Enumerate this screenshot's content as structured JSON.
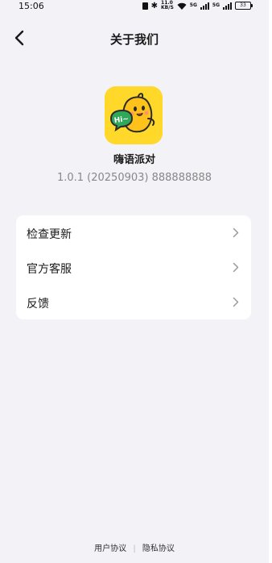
{
  "status_bar": {
    "time": "15:06",
    "net_speed_top": "11.0",
    "net_speed_bottom": "KB/S",
    "signal_label_1": "5G",
    "signal_label_2": "5G",
    "battery": "33"
  },
  "nav": {
    "title": "关于我们",
    "back_icon": "chevron-left-icon"
  },
  "app": {
    "name": "嗨语派对",
    "version": "1.0.1 (20250903) 888888888",
    "icon_text": "Hi~",
    "icon_bg": "#ffd82a"
  },
  "menu": {
    "items": [
      {
        "label": "检查更新"
      },
      {
        "label": "官方客服"
      },
      {
        "label": "反馈"
      }
    ]
  },
  "footer": {
    "user_agreement": "用户协议",
    "divider": "|",
    "privacy_policy": "隐私协议"
  },
  "colors": {
    "background": "#f2f2f7",
    "card": "#ffffff",
    "accent_yellow": "#ffd82a",
    "accent_green": "#2fa85a"
  }
}
